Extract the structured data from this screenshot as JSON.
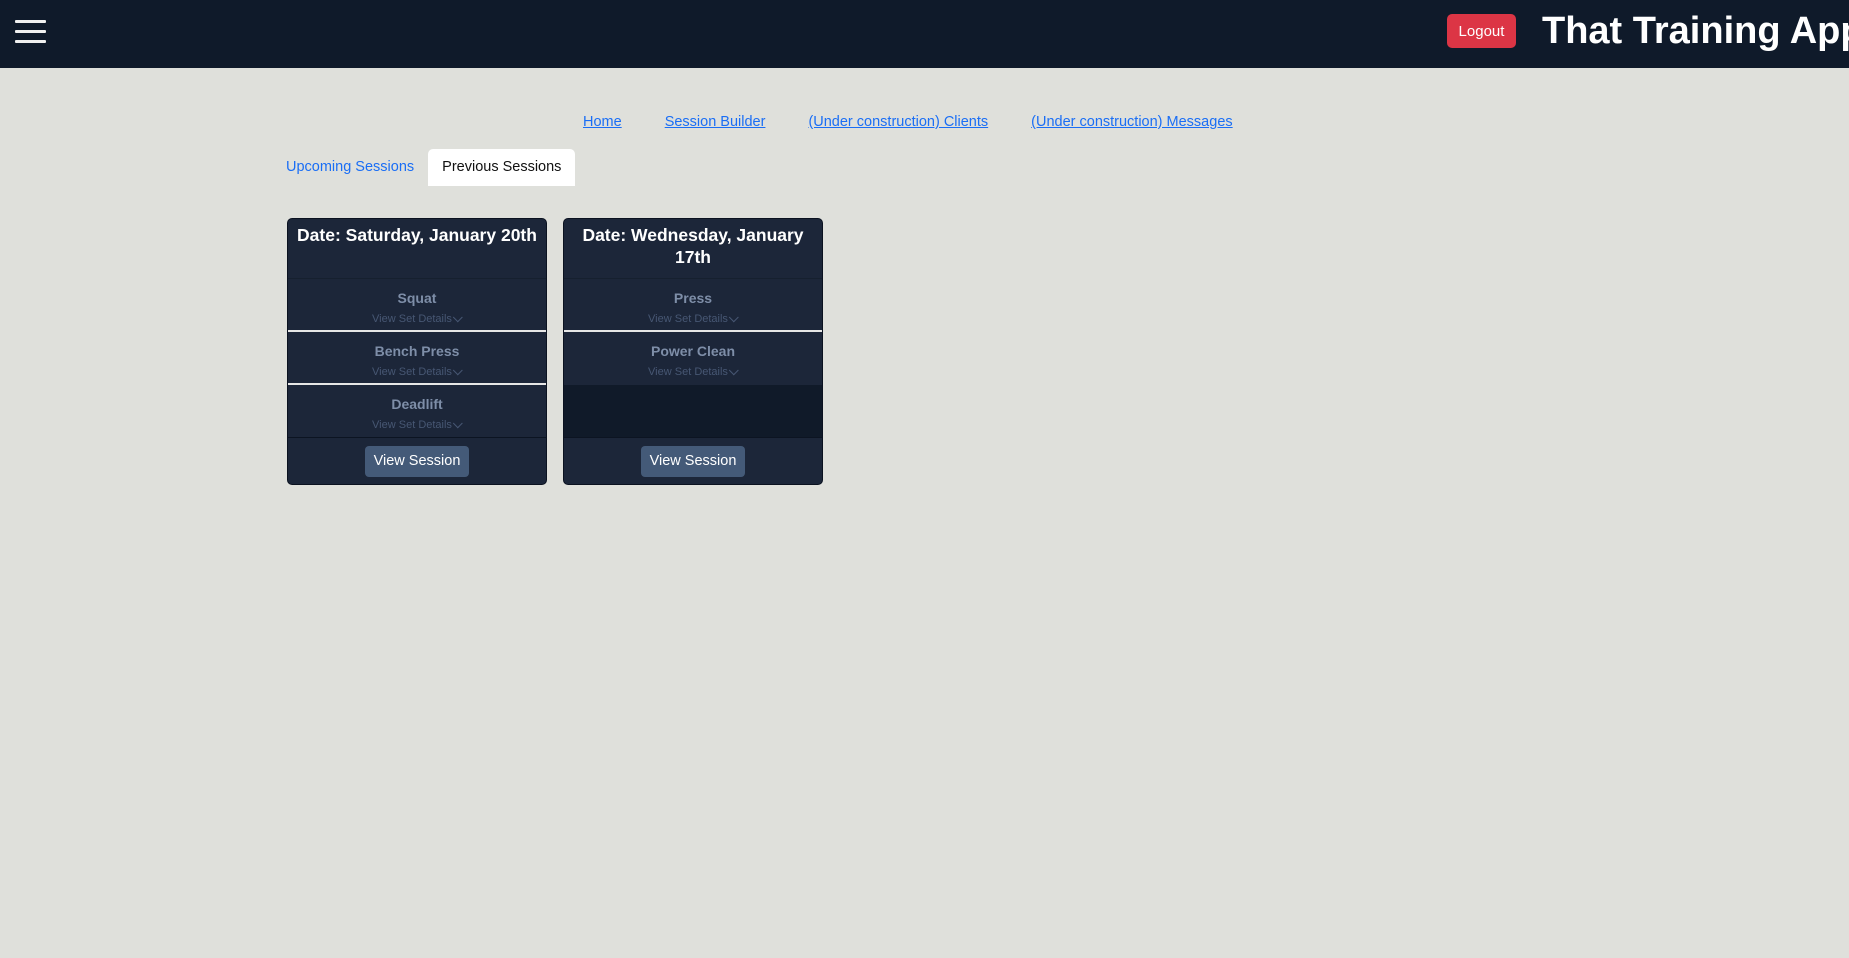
{
  "header": {
    "menu_icon": "hamburger-menu-icon",
    "logout_label": "Logout",
    "app_title": "That Training App",
    "colors": {
      "bar": "#0f1a2a",
      "logout": "#dc3545"
    }
  },
  "nav": {
    "links": [
      {
        "label": "Home"
      },
      {
        "label": "Session Builder"
      },
      {
        "label": "(Under construction) Clients"
      },
      {
        "label": "(Under construction) Messages"
      }
    ]
  },
  "tabs": [
    {
      "label": "Upcoming Sessions",
      "active": false
    },
    {
      "label": "Previous Sessions",
      "active": true
    }
  ],
  "sessions": [
    {
      "date": "Date: Saturday, January 20th",
      "exercises": [
        {
          "name": "Squat",
          "details_label": "View Set Details"
        },
        {
          "name": "Bench Press",
          "details_label": "View Set Details"
        },
        {
          "name": "Deadlift",
          "details_label": "View Set Details"
        }
      ],
      "button_label": "View Session"
    },
    {
      "date": "Date: Wednesday, January 17th",
      "exercises": [
        {
          "name": "Press",
          "details_label": "View Set Details"
        },
        {
          "name": "Power Clean",
          "details_label": "View Set Details"
        }
      ],
      "button_label": "View Session"
    }
  ]
}
